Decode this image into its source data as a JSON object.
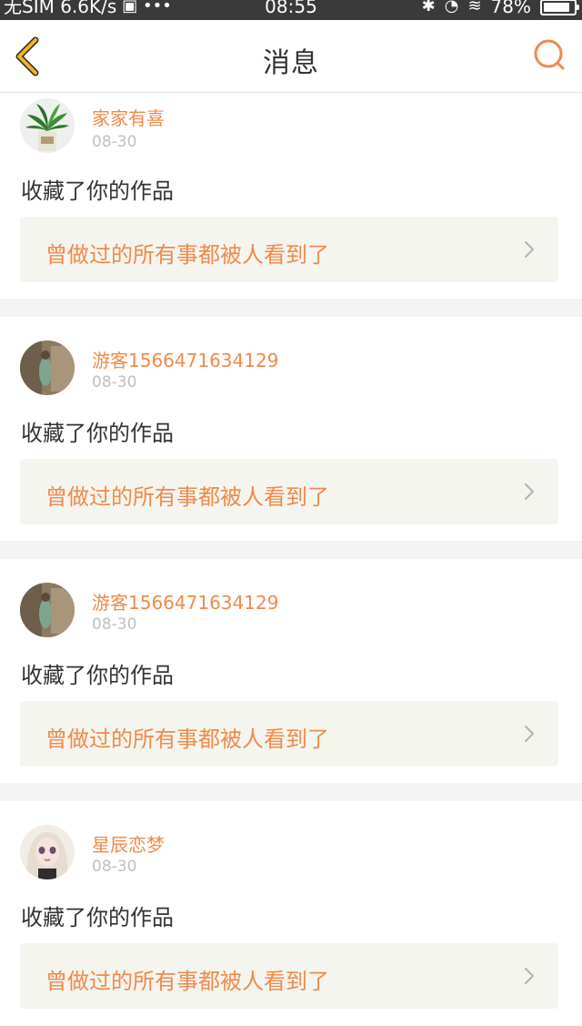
{
  "status_bar": {
    "carrier": "无SIM 6.6K/s",
    "time": "08:55",
    "battery": "78%"
  },
  "header": {
    "title": "消息",
    "back_icon": "chevron-left-icon",
    "search_icon": "search-icon"
  },
  "colors": {
    "accent": "#f08a4b",
    "back_icon": "#f2b51c",
    "work_bg": "#f5f5ef"
  },
  "messages": [
    {
      "username": "家家有喜",
      "date": "08-30",
      "action": "收藏了你的作品",
      "work_title": "曾做过的所有事都被人看到了",
      "avatar": "plant-avatar"
    },
    {
      "username": "游客1566471634129",
      "date": "08-30",
      "action": "收藏了你的作品",
      "work_title": "曾做过的所有事都被人看到了",
      "avatar": "photo-avatar"
    },
    {
      "username": "游客1566471634129",
      "date": "08-30",
      "action": "收藏了你的作品",
      "work_title": "曾做过的所有事都被人看到了",
      "avatar": "photo-avatar"
    },
    {
      "username": "星辰恋梦",
      "date": "08-30",
      "action": "收藏了你的作品",
      "work_title": "曾做过的所有事都被人看到了",
      "avatar": "doll-avatar"
    }
  ]
}
